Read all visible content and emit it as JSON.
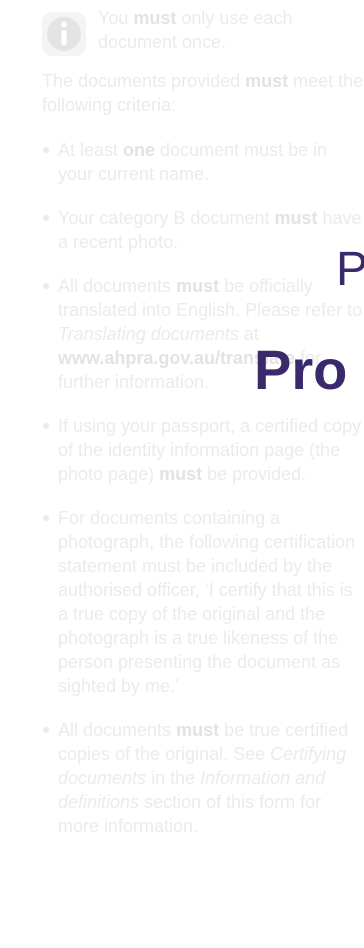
{
  "info": {
    "icon": "info-icon",
    "text_pre": "You ",
    "text_bold": "must",
    "text_post": " only use each document once."
  },
  "intro": {
    "pre": "The documents provided ",
    "bold": "must",
    "post": " meet the following criteria:"
  },
  "bullets": [
    {
      "pre": "At least ",
      "bold": "one",
      "post": " document must be in your current name."
    },
    {
      "pre": "Your category B document ",
      "bold": "must",
      "post": " have a recent photo."
    },
    {
      "pre": "All documents ",
      "bold": "must",
      "mid": " be officially translated into English. Please refer to ",
      "italic": "Translating documents",
      "at": " at ",
      "url": "www.ahpra.gov.au/translate",
      "post": " for further information."
    },
    {
      "pre": "If using your passport, a certified copy of the identity information page (the photo page) ",
      "bold": "must",
      "post": " be provided."
    },
    {
      "text": "For documents containing a photograph, the following certification statement must be included by the authorised officer, ‘I certify that this is a true copy of the original and the photograph is a true likeness of the person presenting the document as sighted by me.’"
    },
    {
      "pre": "All documents ",
      "bold": "must",
      "mid": " be true certified copies of the original. See ",
      "italic1": "Certifying documents",
      "in": " in the ",
      "italic2": "Information and definitions",
      "post": " section of this form for more information."
    }
  ],
  "overlay": {
    "p": "P",
    "pro": "Pro",
    "color": "#3a2a6b"
  }
}
